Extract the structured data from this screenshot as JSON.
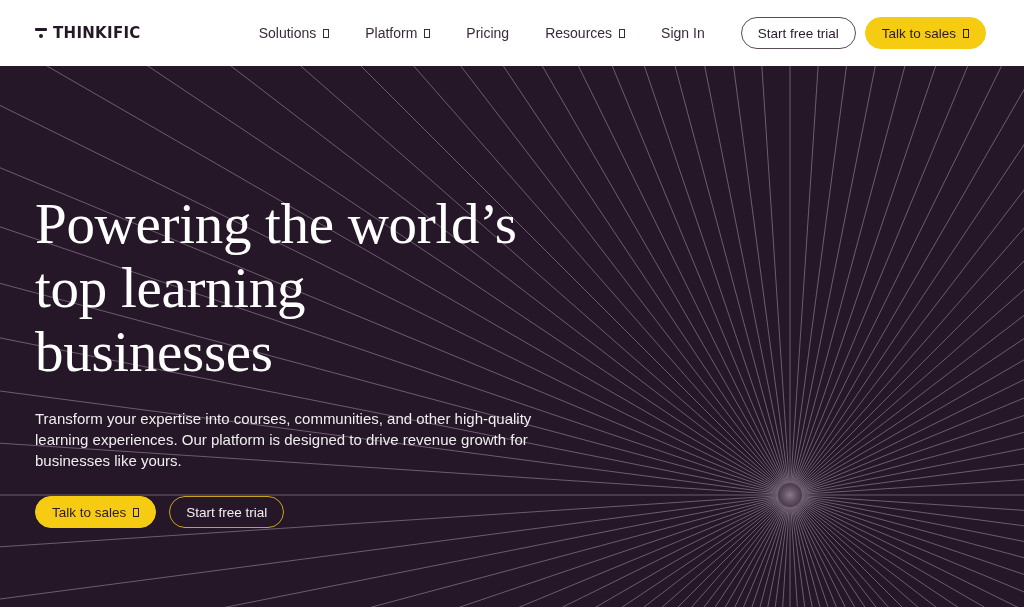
{
  "header": {
    "logo": "THINKIFIC",
    "nav": [
      {
        "label": "Solutions",
        "has_menu": true
      },
      {
        "label": "Platform",
        "has_menu": true
      },
      {
        "label": "Pricing",
        "has_menu": false
      },
      {
        "label": "Resources",
        "has_menu": true
      },
      {
        "label": "Sign In",
        "has_menu": false
      }
    ],
    "buttons": [
      {
        "label": "Start free trial",
        "kind": "outline",
        "has_menu": false
      },
      {
        "label": "Talk to sales",
        "kind": "filled",
        "has_menu": true
      }
    ]
  },
  "hero": {
    "title": "Powering the world’s top learning businesses",
    "text": "Transform your expertise into courses, communities, and other high-quality learning experiences. Our platform is designed to drive revenue growth for businesses like yours.",
    "buttons": [
      {
        "label": "Talk to sales",
        "kind": "filled",
        "has_menu": true
      },
      {
        "label": "Start free trial",
        "kind": "outline",
        "has_menu": false
      }
    ]
  }
}
